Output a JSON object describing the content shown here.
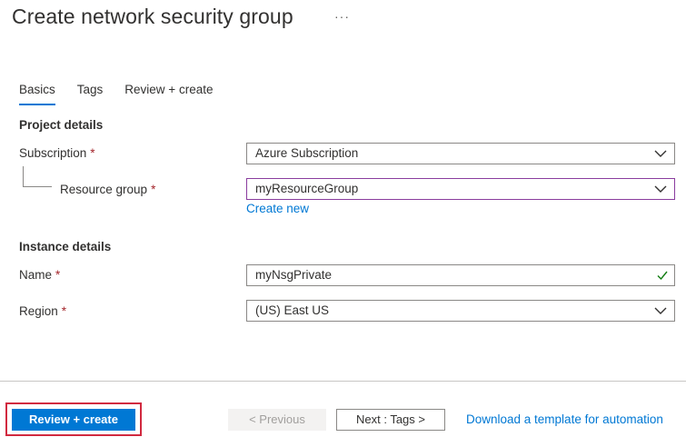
{
  "header": {
    "title": "Create network security group",
    "more_label": "···"
  },
  "tabs": [
    {
      "label": "Basics",
      "active": true
    },
    {
      "label": "Tags",
      "active": false
    },
    {
      "label": "Review + create",
      "active": false
    }
  ],
  "project_details": {
    "heading": "Project details",
    "subscription": {
      "label": "Subscription",
      "required_mark": "*",
      "value": "Azure Subscription"
    },
    "resource_group": {
      "label": "Resource group",
      "required_mark": "*",
      "value": "myResourceGroup",
      "create_new_label": "Create new"
    }
  },
  "instance_details": {
    "heading": "Instance details",
    "name": {
      "label": "Name",
      "required_mark": "*",
      "value": "myNsgPrivate",
      "status_icon": "checkmark-icon"
    },
    "region": {
      "label": "Region",
      "required_mark": "*",
      "value": "(US) East US"
    }
  },
  "footer": {
    "review_create_label": "Review + create",
    "previous_label": "< Previous",
    "next_label": "Next : Tags >",
    "download_label": "Download a template for automation"
  },
  "colors": {
    "accent": "#0078d4",
    "focus_border": "#8a3c9e",
    "highlight": "#d1293f",
    "valid": "#107c10",
    "required": "#a4262c"
  }
}
